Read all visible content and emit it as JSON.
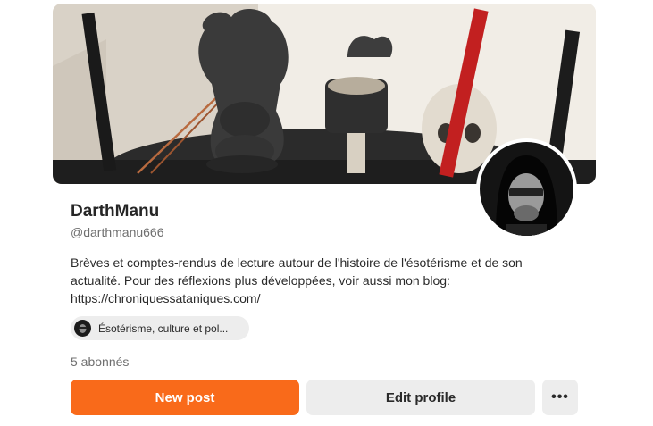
{
  "profile": {
    "display_name": "DarthManu",
    "handle": "@darthmanu666",
    "bio": "Brèves et comptes-rendus de lecture autour de l'histoire de l'ésotérisme et de son actualité. Pour des réflexions plus développées, voir aussi mon blog: https://chroniquessataniques.com/",
    "followers": "5 abonnés"
  },
  "community": {
    "label": "Ésotérisme, culture et pol..."
  },
  "actions": {
    "new_post_label": "New post",
    "edit_profile_label": "Edit profile",
    "more_label": "•••"
  },
  "colors": {
    "primary": "#f96a1a",
    "secondary_bg": "#ededed",
    "muted_text": "#6f6f6f"
  },
  "icons": {
    "banner": "banner-image",
    "avatar": "profile-avatar",
    "community": "community-avatar",
    "more": "more-dots-icon"
  }
}
